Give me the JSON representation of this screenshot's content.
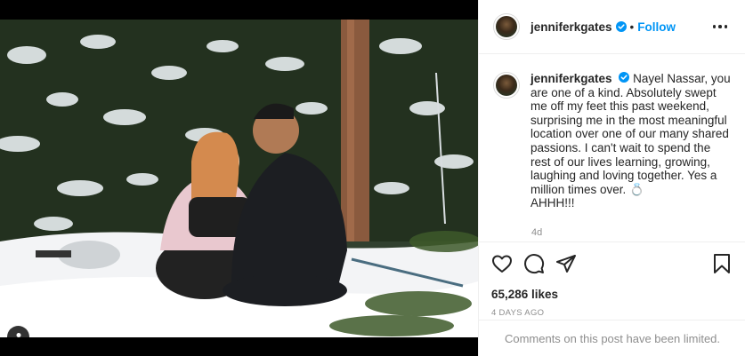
{
  "post": {
    "username": "jenniferkgates",
    "follow_label": "Follow",
    "separator": "•",
    "caption": {
      "username": "jenniferkgates",
      "text": "Nayel Nassar, you are one of a kind. Absolutely swept me off my feet this past weekend, surprising me in the most meaningful location over one of our many shared passions. I can't wait to spend the rest of our lives learning, growing, laughing and loving together. Yes a million times over. 💍\nAHHH!!!",
      "age": "4d"
    },
    "likes": "65,286 likes",
    "date": "4 DAYS AGO",
    "comments_limited": "Comments on this post have been limited."
  },
  "icons": {
    "verified": "verified-badge-icon",
    "more": "more-options-icon",
    "like": "heart-icon",
    "comment": "comment-icon",
    "share": "share-icon",
    "save": "bookmark-icon",
    "user_tag": "user-tag-icon"
  },
  "colors": {
    "accent": "#0095f6",
    "text": "#262626",
    "muted": "#8e8e8e",
    "border": "#efefef"
  }
}
